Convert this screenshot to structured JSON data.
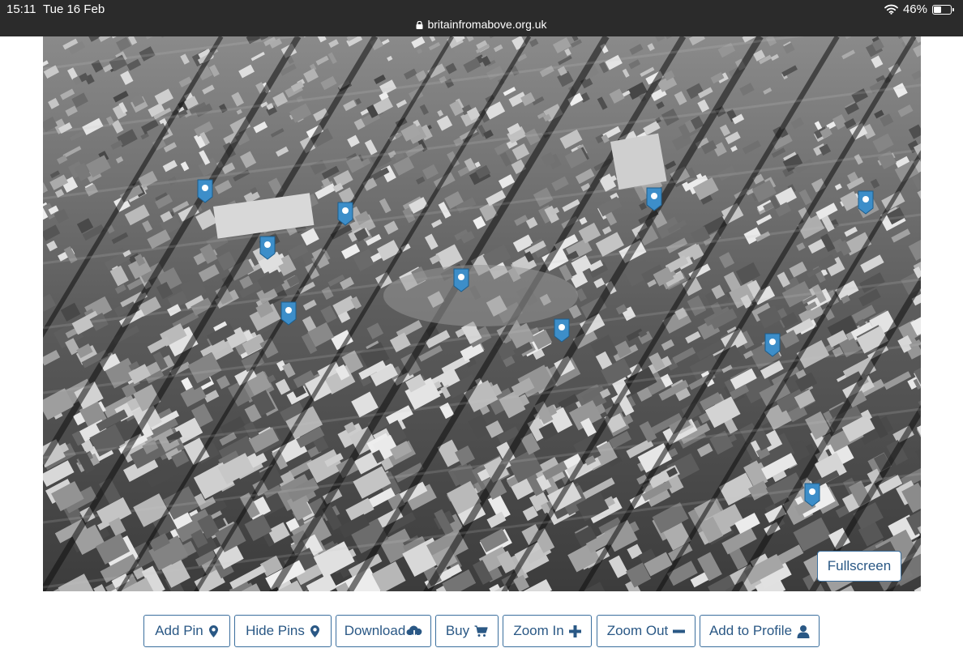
{
  "status_bar": {
    "time": "15:11",
    "date": "Tue 16 Feb",
    "url": "britainfromabove.org.uk",
    "battery": "46%",
    "battery_level": 0.46
  },
  "photo": {
    "fullscreen_label": "Fullscreen",
    "pin_color": "#3d8ec9"
  },
  "toolbar": {
    "add_pin": "Add Pin",
    "hide_pins": "Hide Pins",
    "download": "Download",
    "buy": "Buy",
    "zoom_in": "Zoom In",
    "zoom_out": "Zoom Out",
    "add_to_profile": "Add to Profile"
  },
  "colors": {
    "button_border": "#3b6f9e",
    "button_text": "#2a5885",
    "status_bar_bg": "#2b2b2b"
  }
}
